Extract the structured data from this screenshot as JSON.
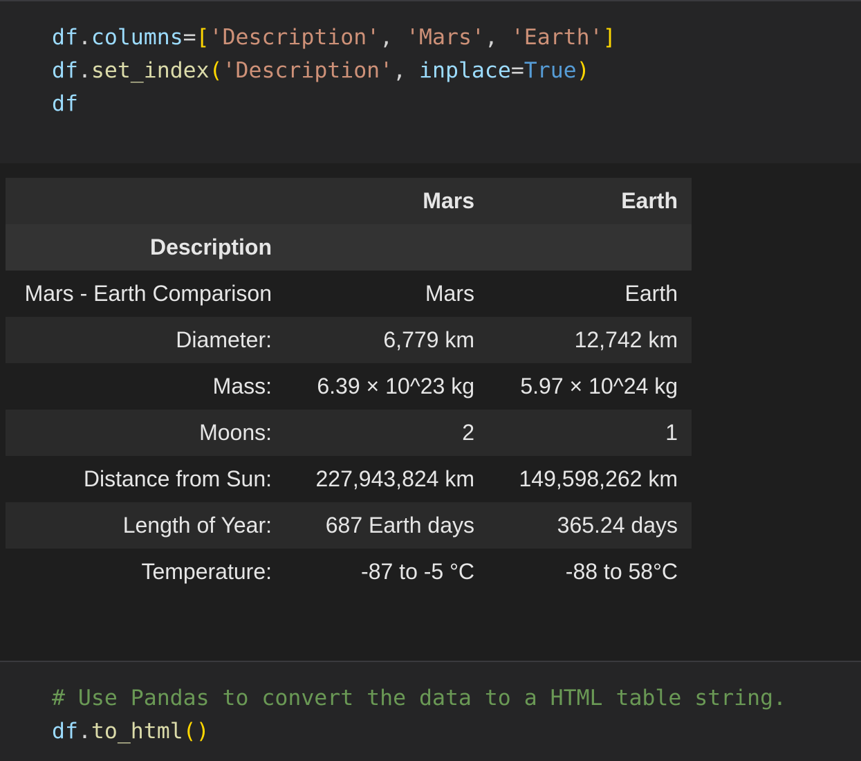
{
  "cell1": {
    "lines": [
      [
        [
          "v",
          "df"
        ],
        [
          "p",
          "."
        ],
        [
          "v",
          "columns"
        ],
        [
          "p",
          "="
        ],
        [
          "b",
          "["
        ],
        [
          "s",
          "'Description'"
        ],
        [
          "p",
          ", "
        ],
        [
          "s",
          "'Mars'"
        ],
        [
          "p",
          ", "
        ],
        [
          "s",
          "'Earth'"
        ],
        [
          "b",
          "]"
        ]
      ],
      [
        [
          "v",
          "df"
        ],
        [
          "p",
          "."
        ],
        [
          "f",
          "set_index"
        ],
        [
          "b",
          "("
        ],
        [
          "s",
          "'Description'"
        ],
        [
          "p",
          ", "
        ],
        [
          "v",
          "inplace"
        ],
        [
          "p",
          "="
        ],
        [
          "k",
          "True"
        ],
        [
          "b",
          ")"
        ]
      ],
      [
        [
          "v",
          "df"
        ]
      ]
    ]
  },
  "table": {
    "columns": [
      "",
      "Mars",
      "Earth"
    ],
    "index_name": "Description",
    "rows": [
      [
        "Mars - Earth Comparison",
        "Mars",
        "Earth"
      ],
      [
        "Diameter:",
        "6,779 km",
        "12,742 km"
      ],
      [
        "Mass:",
        "6.39 × 10^23 kg",
        "5.97 × 10^24 kg"
      ],
      [
        "Moons:",
        "2",
        "1"
      ],
      [
        "Distance from Sun:",
        "227,943,824 km",
        "149,598,262 km"
      ],
      [
        "Length of Year:",
        "687 Earth days",
        "365.24 days"
      ],
      [
        "Temperature:",
        "-87 to -5 °C",
        "-88 to 58°C"
      ]
    ]
  },
  "cell2": {
    "lines": [
      [
        [
          "c",
          "# Use Pandas to convert the data to a HTML table string."
        ]
      ],
      [
        [
          "v",
          "df"
        ],
        [
          "p",
          "."
        ],
        [
          "f",
          "to_html"
        ],
        [
          "b",
          "()"
        ]
      ]
    ]
  }
}
